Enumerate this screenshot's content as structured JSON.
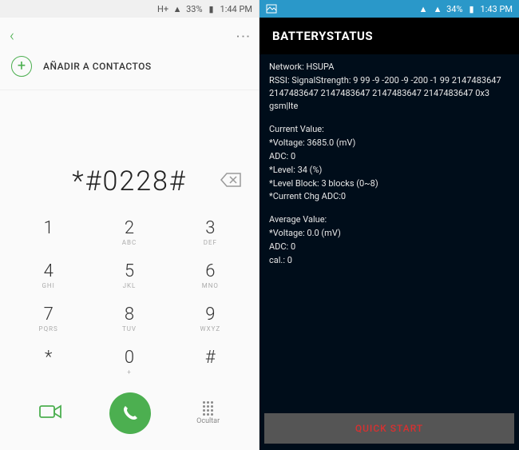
{
  "left": {
    "statusbar": {
      "network": "H+",
      "signal": "▮",
      "battery_pct": "33%",
      "time": "1:44 PM"
    },
    "add_contact_label": "AÑADIR A CONTACTOS",
    "dialed": "*#0228#",
    "keys": [
      {
        "n": "1",
        "s": ""
      },
      {
        "n": "2",
        "s": "ABC"
      },
      {
        "n": "3",
        "s": "DEF"
      },
      {
        "n": "4",
        "s": "GHI"
      },
      {
        "n": "5",
        "s": "JKL"
      },
      {
        "n": "6",
        "s": "MNO"
      },
      {
        "n": "7",
        "s": "PQRS"
      },
      {
        "n": "8",
        "s": "TUV"
      },
      {
        "n": "9",
        "s": "WXYZ"
      },
      {
        "n": "*",
        "s": ""
      },
      {
        "n": "0",
        "s": "+"
      },
      {
        "n": "#",
        "s": ""
      }
    ],
    "hide_label": "Ocultar"
  },
  "right": {
    "statusbar": {
      "battery_pct": "34%",
      "time": "1:43 PM"
    },
    "title": "BATTERYSTATUS",
    "network_line": "Network: HSUPA",
    "rssi_line": "RSSI: SignalStrength: 9 99 -9 -200 -9 -200 -1 99 2147483647 2147483647 2147483647 2147483647 2147483647 0x3 gsm|lte",
    "cv_header": "Current Value:",
    "cv_voltage": "*Voltage: 3685.0 (mV)",
    "cv_adc": "   ADC: 0",
    "cv_level": "*Level: 34 (%)",
    "cv_block": "*Level Block: 3 blocks (0~8)",
    "cv_chg": "*Current Chg ADC:0",
    "av_header": "Average Value:",
    "av_voltage": "*Voltage: 0.0 (mV)",
    "av_adc": "   ADC: 0",
    "av_cal": "   cal.: 0",
    "quick_start": "QUICK START"
  }
}
